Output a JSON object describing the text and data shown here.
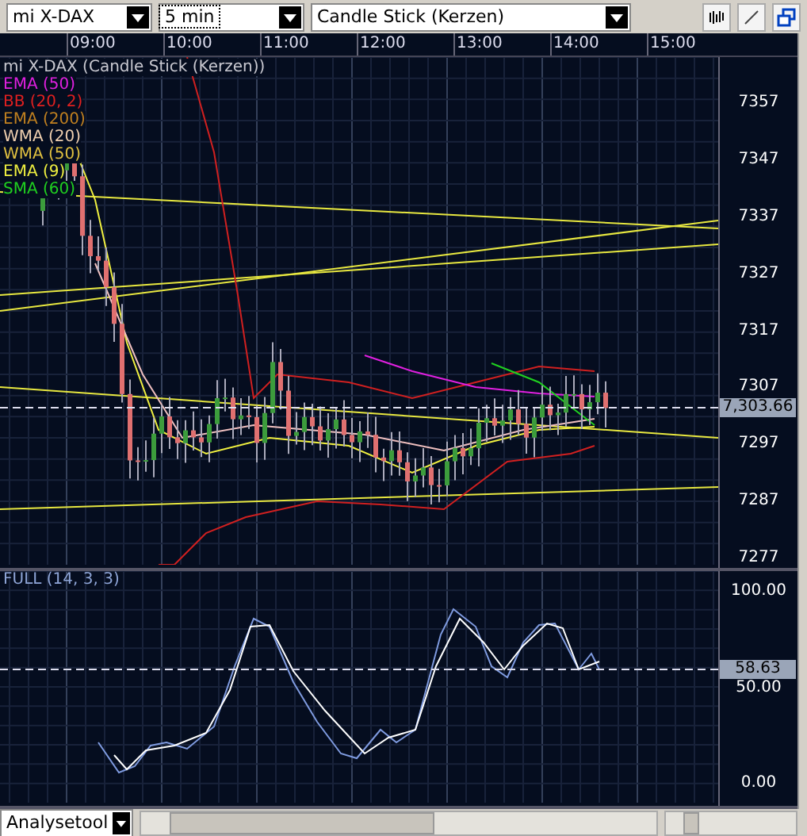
{
  "toolbar": {
    "instrument": "mi X-DAX",
    "interval": "5 min",
    "chart_type": "Candle Stick (Kerzen)"
  },
  "time_axis": [
    "09:00",
    "10:00",
    "11:00",
    "12:00",
    "13:00",
    "14:00",
    "15:00"
  ],
  "price_chart": {
    "title": "mi X-DAX (Candle Stick (Kerzen))",
    "legend": [
      {
        "label": "EMA (50)",
        "color": "#e020e0"
      },
      {
        "label": "BB (20, 2)",
        "color": "#e02020"
      },
      {
        "label": "EMA (200)",
        "color": "#c08020"
      },
      {
        "label": "WMA (20)",
        "color": "#f0d0b0"
      },
      {
        "label": "WMA (50)",
        "color": "#e0c040"
      },
      {
        "label": "EMA (9)",
        "color": "#f0f040"
      },
      {
        "label": "SMA (60)",
        "color": "#20d020"
      }
    ],
    "price_labels": [
      "7357",
      "7347",
      "7337",
      "7327",
      "7317",
      "7307",
      "7297",
      "7287",
      "7277"
    ],
    "last_price": "7,303.66"
  },
  "oscillator": {
    "title": "FULL (14, 3, 3)",
    "labels": [
      "100.00",
      "50.00",
      "0.00"
    ],
    "last_value": "58.63"
  },
  "bottom_bar": {
    "tool": "Analysetool",
    "zoom": {
      "level": 0.15
    }
  }
}
